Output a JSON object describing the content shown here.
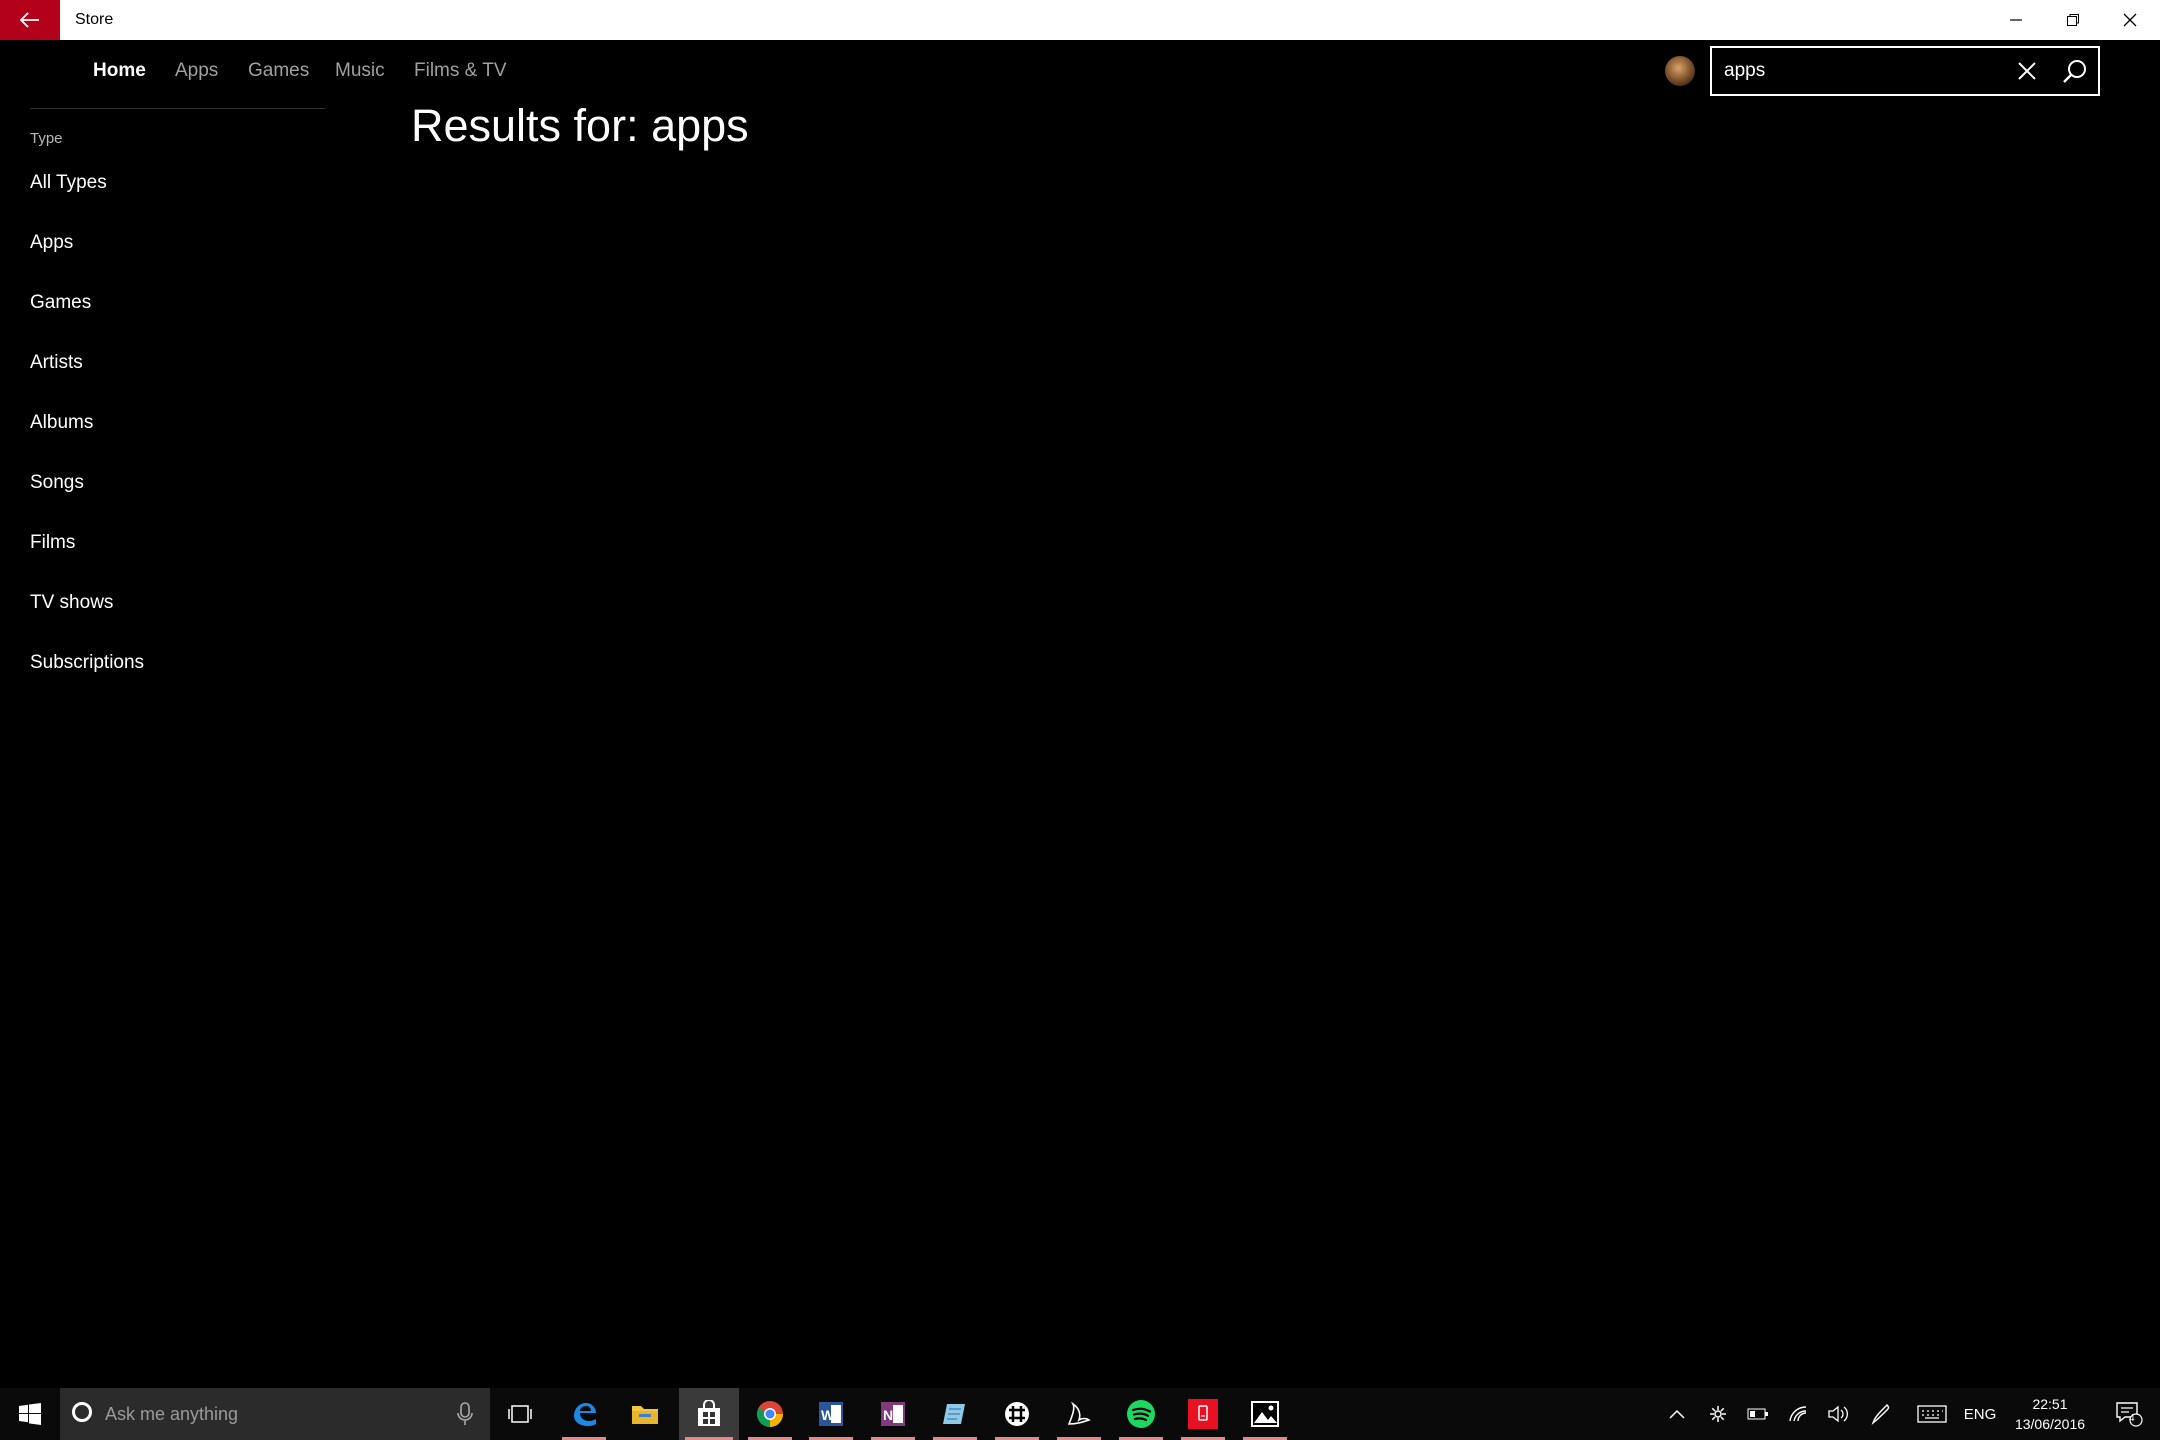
{
  "window": {
    "title": "Store"
  },
  "nav": {
    "items": [
      {
        "label": "Home",
        "active": true
      },
      {
        "label": "Apps",
        "active": false
      },
      {
        "label": "Games",
        "active": false
      },
      {
        "label": "Music",
        "active": false
      },
      {
        "label": "Films & TV",
        "active": false
      }
    ]
  },
  "search": {
    "value": "apps",
    "clear_icon": "close-icon",
    "submit_icon": "search-icon"
  },
  "sidebar": {
    "section_label": "Type",
    "filters": [
      {
        "label": "All Types"
      },
      {
        "label": "Apps"
      },
      {
        "label": "Games"
      },
      {
        "label": "Artists"
      },
      {
        "label": "Albums"
      },
      {
        "label": "Songs"
      },
      {
        "label": "Films"
      },
      {
        "label": "TV shows"
      },
      {
        "label": "Subscriptions"
      }
    ]
  },
  "main": {
    "results_title": "Results for: apps"
  },
  "taskbar": {
    "search_placeholder": "Ask me anything",
    "apps": [
      "task-view",
      "edge",
      "file-explorer",
      "store",
      "chrome",
      "word",
      "onenote",
      "app-blue",
      "slack",
      "app-bird",
      "spotify",
      "app-red",
      "photos"
    ],
    "tray": {
      "language": "ENG",
      "time": "22:51",
      "date": "13/06/2016",
      "notifications": "4"
    }
  },
  "colors": {
    "accent": "#b3001b",
    "background": "#000000",
    "nav_inactive": "#a0a0a0"
  }
}
